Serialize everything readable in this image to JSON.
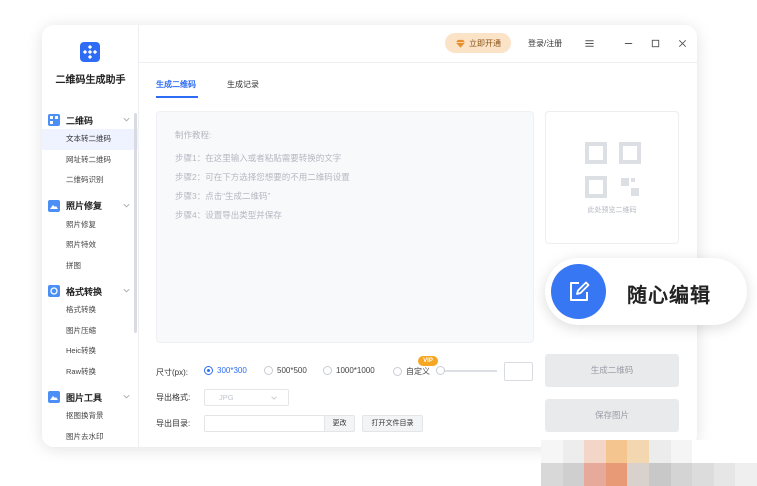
{
  "app": {
    "name": "二维码生成助手"
  },
  "titlebar": {
    "vip_label": "立即开通",
    "login_label": "登录/注册"
  },
  "sidebar": {
    "groups": [
      {
        "label": "二维码",
        "items": [
          "文本转二维码",
          "网址转二维码",
          "二维码识别"
        ],
        "active": 0
      },
      {
        "label": "照片修复",
        "items": [
          "照片修复",
          "照片特效",
          "拼图"
        ]
      },
      {
        "label": "格式转换",
        "items": [
          "格式转换",
          "图片压缩",
          "Heic转换",
          "Raw转换"
        ]
      },
      {
        "label": "图片工具",
        "items": [
          "抠图换背景",
          "图片去水印"
        ]
      }
    ]
  },
  "tabs": [
    {
      "label": "生成二维码",
      "active": true
    },
    {
      "label": "生成记录",
      "active": false
    }
  ],
  "editor": {
    "lines": [
      "制作教程:",
      "步骤1：在这里输入或者粘贴需要转换的文字",
      "步骤2：可在下方选择您想要的不用二维码设置",
      "步骤3：点击“生成二维码”",
      "步骤4：设置导出类型并保存"
    ]
  },
  "preview": {
    "placeholder": "此处预览二维码"
  },
  "size": {
    "label": "尺寸(px):",
    "options": [
      "300*300",
      "500*500",
      "1000*1000",
      "自定义"
    ],
    "selected": "300*300",
    "vip_tag": "VIP"
  },
  "format": {
    "label": "导出格式:",
    "value": "JPG"
  },
  "directory": {
    "label": "导出目录:",
    "change_label": "更改",
    "open_label": "打开文件目录"
  },
  "actions": {
    "generate_label": "生成二维码",
    "save_label": "保存图片"
  },
  "float_card": {
    "label": "随心编辑"
  },
  "colors": {
    "accent": "#2f6cf6",
    "vip_bg": "#fbe3c8",
    "vip_text": "#8a5316",
    "float_icon": "#3777f3"
  }
}
